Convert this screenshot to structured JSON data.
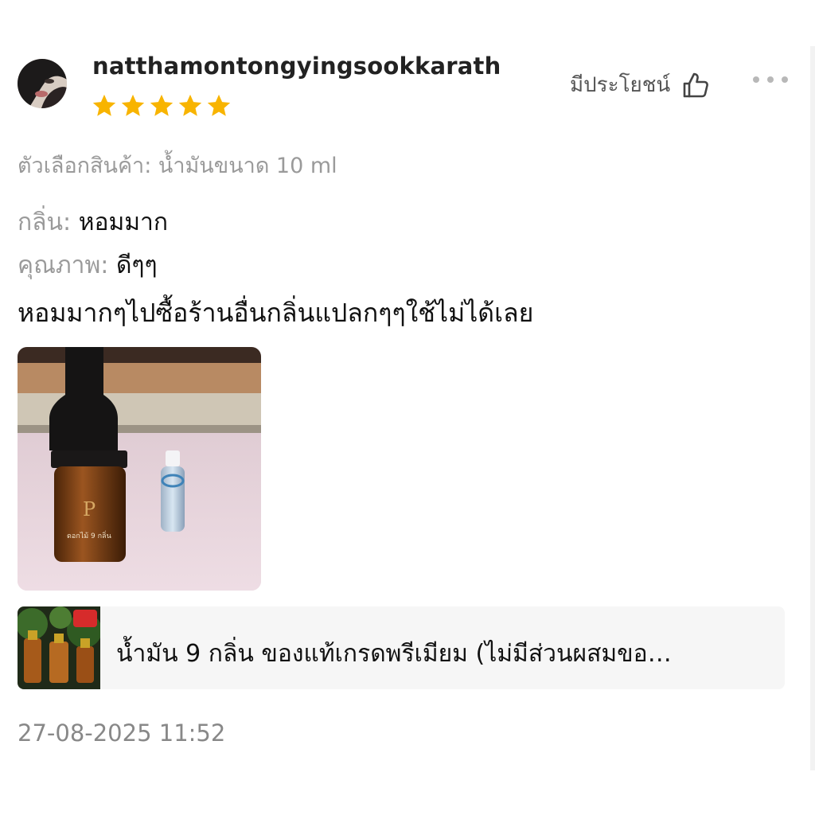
{
  "review": {
    "username": "natthamontongyingsookkarath",
    "rating": 5,
    "helpful_label": "มีประโยชน์",
    "variation": "ตัวเลือกสินค้า: น้ำมันขนาด 10 ml",
    "attributes": [
      {
        "label": "กลิ่น: ",
        "value": "หอมมาก"
      },
      {
        "label": "คุณภาพ: ",
        "value": "ดีๆๆ"
      }
    ],
    "comment": "หอมมากๆไปซื้อร้านอื่นกลิ่นแปลกๆๆใช้ไม่ได้เลย",
    "timestamp": "27-08-2025 11:52"
  },
  "product": {
    "name": "น้ำมัน 9 กลิ่น ของแท้เกรดพรีเมียม  (ไม่มีส่วนผสมขอ…"
  },
  "colors": {
    "star": "#f8b400",
    "muted_text": "#9a9a9a",
    "timestamp_text": "#888888",
    "card_bg": "#f6f6f6"
  },
  "icons": [
    "thumbs-up-icon",
    "more-options-icon",
    "star-icon"
  ]
}
